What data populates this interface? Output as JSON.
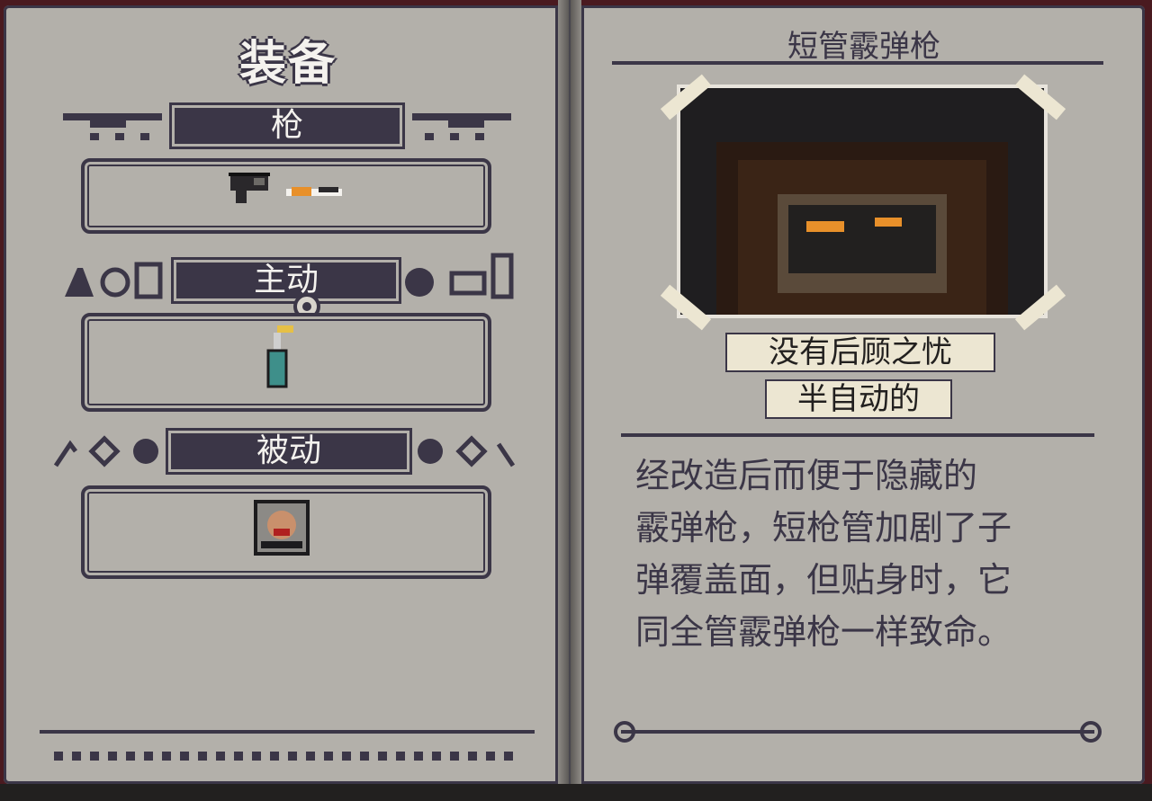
{
  "left": {
    "title": "装备",
    "sections": [
      {
        "id": "guns",
        "label": "枪",
        "items": [
          "pistol-icon",
          "shotgun-icon"
        ]
      },
      {
        "id": "active",
        "label": "主动",
        "items": [
          "molotov-bottle-icon"
        ]
      },
      {
        "id": "passive",
        "label": "被动",
        "items": [
          "portrait-card-icon"
        ]
      }
    ]
  },
  "right": {
    "item_name": "短管霰弹枪",
    "quote": "没有后顾之忧",
    "type": "半自动的",
    "description_lines": [
      "经改造后而便于隐藏的",
      "霰弹枪，短枪管加剧了子",
      "弹覆盖面，但贴身时，它",
      "同全管霰弹枪一样致命。"
    ]
  },
  "colors": {
    "page": "#b3b0aa",
    "ink": "#3b3647",
    "label_fill": "#3b3647",
    "accent_orange": "#e8902a",
    "tape": "#ece6d2"
  }
}
